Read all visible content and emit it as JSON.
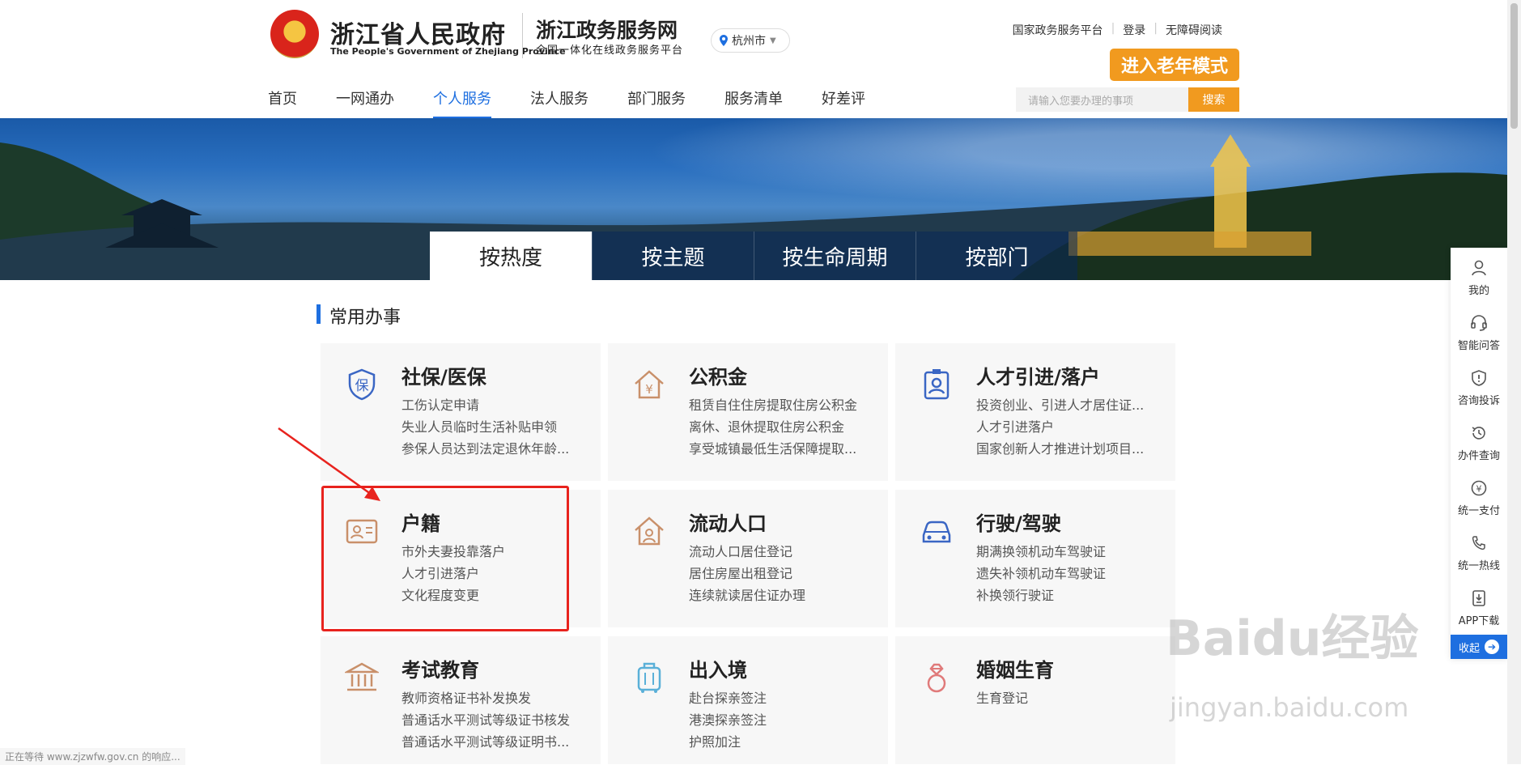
{
  "header": {
    "gov_name": "浙江省人民政府",
    "gov_name_en": "The People's Government of Zhejiang Province",
    "portal_name": "浙江政务服务网",
    "portal_sub": "全国一体化在线政务服务平台",
    "city": "杭州市",
    "top_links": [
      "国家政务服务平台",
      "登录",
      "无障碍阅读"
    ],
    "elder_mode": "进入老年模式"
  },
  "nav": {
    "items": [
      "首页",
      "一网通办",
      "个人服务",
      "法人服务",
      "部门服务",
      "服务清单",
      "好差评"
    ],
    "active": "个人服务"
  },
  "search": {
    "placeholder": "请输入您要办理的事项",
    "button": "搜索"
  },
  "tabs": {
    "items": [
      "按热度",
      "按主题",
      "按生命周期",
      "按部门"
    ],
    "active": "按热度"
  },
  "section": {
    "title": "常用办事"
  },
  "cards": [
    {
      "title": "社保/医保",
      "lines": [
        "工伤认定申请",
        "失业人员临时生活补贴申领",
        "参保人员达到法定退休年龄..."
      ],
      "icon": "shield-bao-icon"
    },
    {
      "title": "公积金",
      "lines": [
        "租赁自住住房提取住房公积金",
        "离休、退休提取住房公积金",
        "享受城镇最低生活保障提取..."
      ],
      "icon": "house-yuan-icon"
    },
    {
      "title": "人才引进/落户",
      "lines": [
        "投资创业、引进人才居住证...",
        "人才引进落户",
        "国家创新人才推进计划项目..."
      ],
      "icon": "badge-person-icon"
    },
    {
      "title": "户籍",
      "lines": [
        "市外夫妻投靠落户",
        "人才引进落户",
        "文化程度变更"
      ],
      "icon": "id-card-icon"
    },
    {
      "title": "流动人口",
      "lines": [
        "流动人口居住登记",
        "居住房屋出租登记",
        "连续就读居住证办理"
      ],
      "icon": "house-person-icon"
    },
    {
      "title": "行驶/驾驶",
      "lines": [
        "期满换领机动车驾驶证",
        "遗失补领机动车驾驶证",
        "补换领行驶证"
      ],
      "icon": "car-icon"
    },
    {
      "title": "考试教育",
      "lines": [
        "教师资格证书补发换发",
        "普通话水平测试等级证书核发",
        "普通话水平测试等级证明书..."
      ],
      "icon": "bank-building-icon"
    },
    {
      "title": "出入境",
      "lines": [
        "赴台探亲签注",
        "港澳探亲签注",
        "护照加注"
      ],
      "icon": "luggage-icon"
    },
    {
      "title": "婚姻生育",
      "lines": [
        "生育登记"
      ],
      "icon": "diamond-ring-icon"
    }
  ],
  "dock": {
    "items": [
      "我的",
      "智能问答",
      "咨询投诉",
      "办件查询",
      "统一支付",
      "统一热线",
      "APP下载"
    ],
    "collapse": "收起"
  },
  "status_text": "正在等待 www.zjzwfw.gov.cn 的响应...",
  "watermark": {
    "brand": "Baidu经验",
    "url": "jingyan.baidu.com"
  },
  "colors": {
    "accent": "#1e6fe0",
    "orange": "#f19a1f",
    "highlight": "#e8231e",
    "icon_tan": "#c9906a",
    "icon_blue": "#3a66c4"
  }
}
